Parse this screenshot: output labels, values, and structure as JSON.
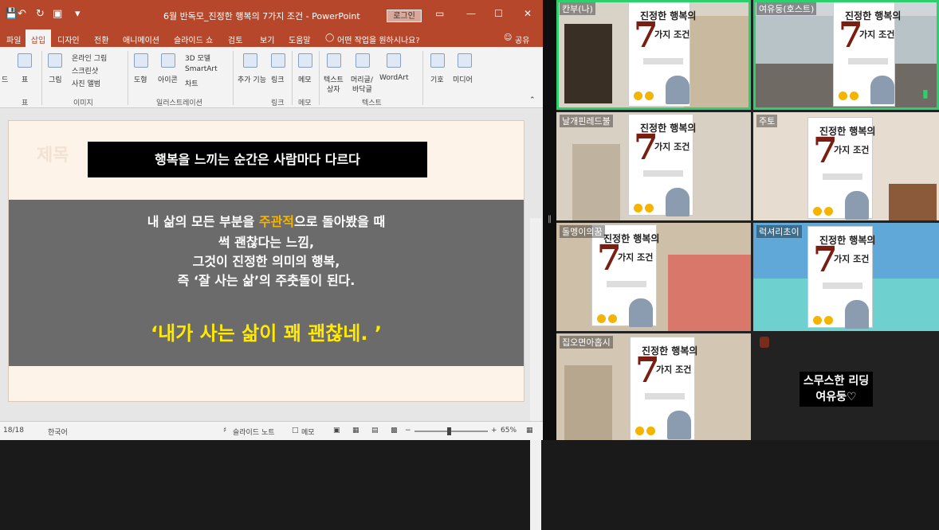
{
  "powerpoint": {
    "title": "6월 반독모_진정한 행복의 7가지 조건 - PowerPoint",
    "login_label": "로그인",
    "quick_icons": {
      "save": "💾",
      "undo": "↶",
      "redo": "↻",
      "present": "▣",
      "more": "▾"
    },
    "window_controls": {
      "ribbon_display": "▭",
      "minimize": "—",
      "maximize": "☐",
      "close": "✕"
    },
    "menu": [
      "파일",
      "삽입",
      "디자인",
      "전환",
      "애니메이션",
      "슬라이드 쇼",
      "검토",
      "보기",
      "도움말"
    ],
    "menu_search": "어떤 작업을 원하시나요?",
    "share": "공유",
    "ribbon": {
      "slide_item": "드",
      "table": "표",
      "images": "그림",
      "online_images": "온라인 그림",
      "screenshot": "스크린샷",
      "photo_album": "사진 앨범",
      "shapes": "도형",
      "icons": "아이콘",
      "model3d": "3D 모델",
      "smartart": "SmartArt",
      "chart": "차트",
      "addins": "추가 기능",
      "link": "링크",
      "comment": "메모",
      "textbox_1": "텍스트",
      "textbox_2": "상자",
      "header_1": "머리글/",
      "header_2": "바닥글",
      "wordart": "WordArt",
      "symbols": "기호",
      "media": "미디어",
      "groups": {
        "image": "이미지",
        "illustration": "일러스트레이션",
        "link": "링크",
        "comment": "메모",
        "text": "텍스트",
        "table": "표"
      }
    },
    "slide": {
      "ghost_title": "제목",
      "heading": "행복을 느끼는 순간은 사람마다 다르다",
      "line1_before": "내 삶의 모든 부분을 ",
      "line1_highlight": "주관적",
      "line1_after": "으로 돌아봤을 때",
      "line2": "썩 괜찮다는 느낌,",
      "line3": "그것이 진정한 의미의 행복,",
      "line4": "즉 ‘잘 사는 삶’의 주춧돌이 된다.",
      "quote": "‘내가 사는 삶이 꽤 괜찮네. ’"
    },
    "status": {
      "slide_counter": "18/18",
      "language": "한국어",
      "notes": "슬라이드 노트",
      "comments": "메모",
      "zoom_minus": "−",
      "zoom_plus": "+",
      "zoom": "65%"
    }
  },
  "zoom": {
    "participants": [
      {
        "name": "칸부(나)",
        "active": true
      },
      {
        "name": "여유둥(호스트)",
        "active": true
      },
      {
        "name": "날개핀레드불",
        "active": false
      },
      {
        "name": "주토",
        "active": false
      },
      {
        "name": "돌멩이의꿈",
        "active": false
      },
      {
        "name": "럭셔리초이",
        "active": false
      },
      {
        "name": "집오면아홉시",
        "active": false
      }
    ],
    "book": {
      "line1": "진정한 행복의",
      "seven": "7",
      "line2": "가지 조건"
    },
    "lead_text_1": "스무스한 리딩",
    "lead_text_2": "여유둥♡",
    "colors": {
      "active_border": "#2ed06e",
      "accent": "#b7472a"
    }
  }
}
